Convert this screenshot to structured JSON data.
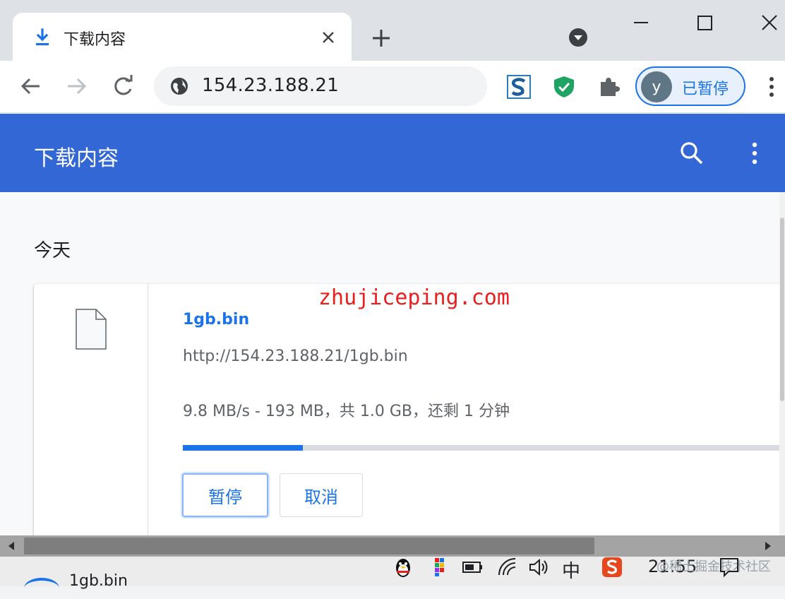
{
  "tab": {
    "title": "下载内容",
    "favicon_icon": "download-icon",
    "close_icon": "close-icon"
  },
  "toolbar": {
    "address": "154.23.188.21",
    "site_icon": "globe-icon",
    "profile_initial": "y",
    "profile_status": "已暂停"
  },
  "downloads": {
    "header_title": "下载内容",
    "section_date": "今天",
    "items": [
      {
        "name": "1gb.bin",
        "url": "http://154.23.188.21/1gb.bin",
        "status": "9.8 MB/s - 193 MB，共 1.0 GB，还剩 1 分钟",
        "progress_fraction": 0.2,
        "pause_label": "暂停",
        "cancel_label": "取消"
      }
    ]
  },
  "watermark": {
    "site": "zhujiceping.com",
    "juejin": "@稀土掘金技术社区"
  },
  "taskbar": {
    "item_name": "1gb.bin",
    "ime": "中",
    "clock": "21:55"
  },
  "colors": {
    "accent": "#1a73e8",
    "header_blue": "#3367d6",
    "watermark_red": "#e8201e"
  }
}
